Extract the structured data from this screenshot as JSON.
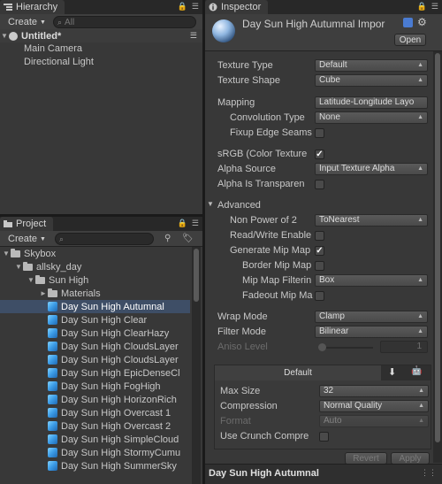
{
  "hierarchy": {
    "tab_label": "Hierarchy",
    "create_label": "Create",
    "search_placeholder": "All",
    "scene_name": "Untitled*",
    "objects": [
      "Main Camera",
      "Directional Light"
    ]
  },
  "project": {
    "tab_label": "Project",
    "create_label": "Create",
    "tree": [
      {
        "label": "Skybox",
        "type": "folder",
        "level": 0,
        "fold": "▼"
      },
      {
        "label": "allsky_day",
        "type": "folder",
        "level": 1,
        "fold": "▼"
      },
      {
        "label": "Sun High",
        "type": "folder",
        "level": 2,
        "fold": "▼"
      },
      {
        "label": "Materials",
        "type": "folder",
        "level": 3,
        "fold": "►"
      },
      {
        "label": "Day Sun High Autumnal",
        "type": "cubemap",
        "level": 3,
        "selected": true
      },
      {
        "label": "Day Sun High Clear",
        "type": "cubemap",
        "level": 3
      },
      {
        "label": "Day Sun High ClearHazy",
        "type": "cubemap",
        "level": 3
      },
      {
        "label": "Day Sun High CloudsLayer",
        "type": "cubemap",
        "level": 3
      },
      {
        "label": "Day Sun High CloudsLayer",
        "type": "cubemap",
        "level": 3
      },
      {
        "label": "Day Sun High EpicDenseCl",
        "type": "cubemap",
        "level": 3
      },
      {
        "label": "Day Sun High FogHigh",
        "type": "cubemap",
        "level": 3
      },
      {
        "label": "Day Sun High HorizonRich",
        "type": "cubemap",
        "level": 3
      },
      {
        "label": "Day Sun High Overcast 1",
        "type": "cubemap",
        "level": 3
      },
      {
        "label": "Day Sun High Overcast 2",
        "type": "cubemap",
        "level": 3
      },
      {
        "label": "Day Sun High SimpleCloud",
        "type": "cubemap",
        "level": 3
      },
      {
        "label": "Day Sun High StormyCumu",
        "type": "cubemap",
        "level": 3
      },
      {
        "label": "Day Sun High SummerSky",
        "type": "cubemap",
        "level": 3
      }
    ]
  },
  "inspector": {
    "tab_label": "Inspector",
    "asset_title": "Day Sun High Autumnal Impor",
    "open_label": "Open",
    "texture_type_label": "Texture Type",
    "texture_type_value": "Default",
    "texture_shape_label": "Texture Shape",
    "texture_shape_value": "Cube",
    "mapping_label": "Mapping",
    "mapping_value": "Latitude-Longitude Layo",
    "convolution_label": "Convolution Type",
    "convolution_value": "None",
    "fixup_label": "Fixup Edge Seams",
    "srgb_label": "sRGB (Color Texture",
    "alpha_source_label": "Alpha Source",
    "alpha_source_value": "Input Texture Alpha",
    "alpha_transparent_label": "Alpha Is Transparen",
    "advanced_label": "Advanced",
    "npot_label": "Non Power of 2",
    "npot_value": "ToNearest",
    "readwrite_label": "Read/Write Enable",
    "genmip_label": "Generate Mip Map",
    "bordermip_label": "Border Mip Map",
    "mipfilter_label": "Mip Map Filterin",
    "mipfilter_value": "Box",
    "fadeout_label": "Fadeout Mip Ma",
    "wrap_label": "Wrap Mode",
    "wrap_value": "Clamp",
    "filter_label": "Filter Mode",
    "filter_value": "Bilinear",
    "aniso_label": "Aniso Level",
    "aniso_value": "1",
    "platform_default": "Default",
    "maxsize_label": "Max Size",
    "maxsize_value": "32",
    "compression_label": "Compression",
    "compression_value": "Normal Quality",
    "format_label": "Format",
    "format_value": "Auto",
    "crunch_label": "Use Crunch Compre",
    "revert_label": "Revert",
    "apply_label": "Apply",
    "footer_title": "Day Sun High Autumnal"
  }
}
